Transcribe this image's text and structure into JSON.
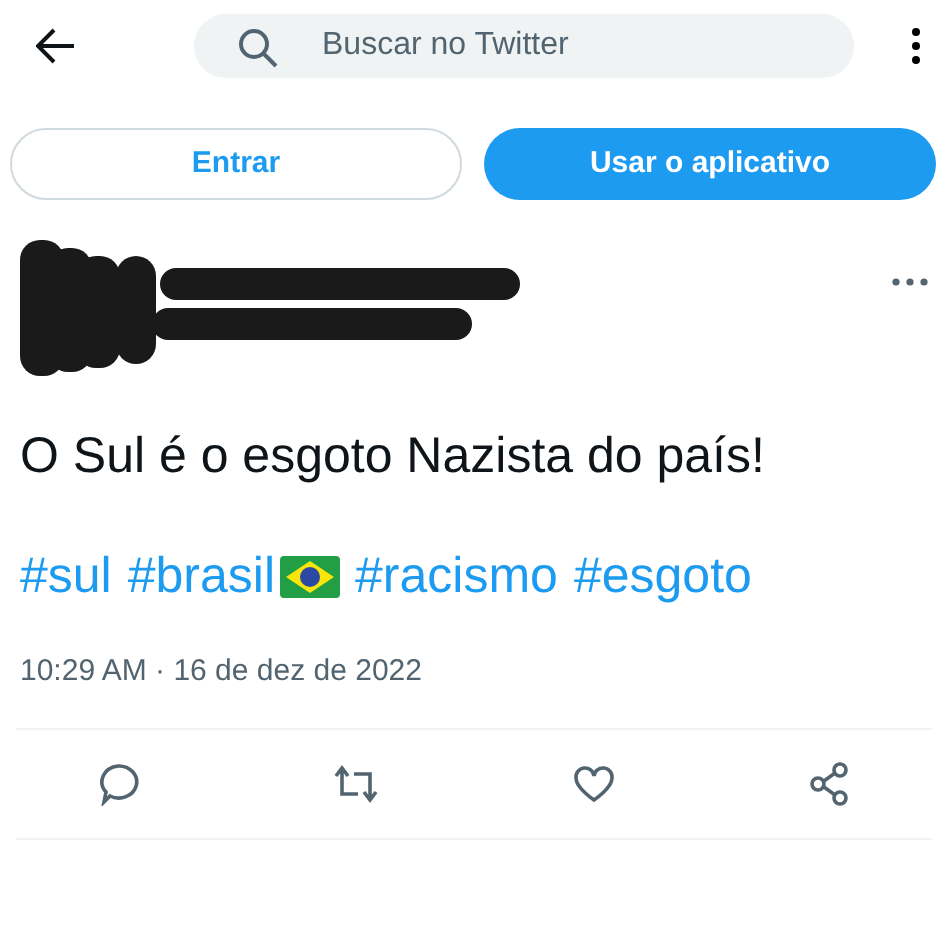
{
  "search": {
    "placeholder": "Buscar no Twitter"
  },
  "buttons": [
    {
      "label": "Entrar",
      "kind": "outline"
    },
    {
      "label": "Usar o aplicativo",
      "kind": "filled"
    }
  ],
  "tweet": {
    "text": "O Sul é o esgoto Nazista do país!",
    "hashtags": [
      {
        "text": "#sul",
        "flag": false
      },
      {
        "text": "#brasil",
        "flag": true
      },
      {
        "text": "#racismo",
        "flag": false
      },
      {
        "text": "#esgoto",
        "flag": false
      }
    ],
    "timestamp": "10:29 AM · 16 de dez de 2022"
  }
}
